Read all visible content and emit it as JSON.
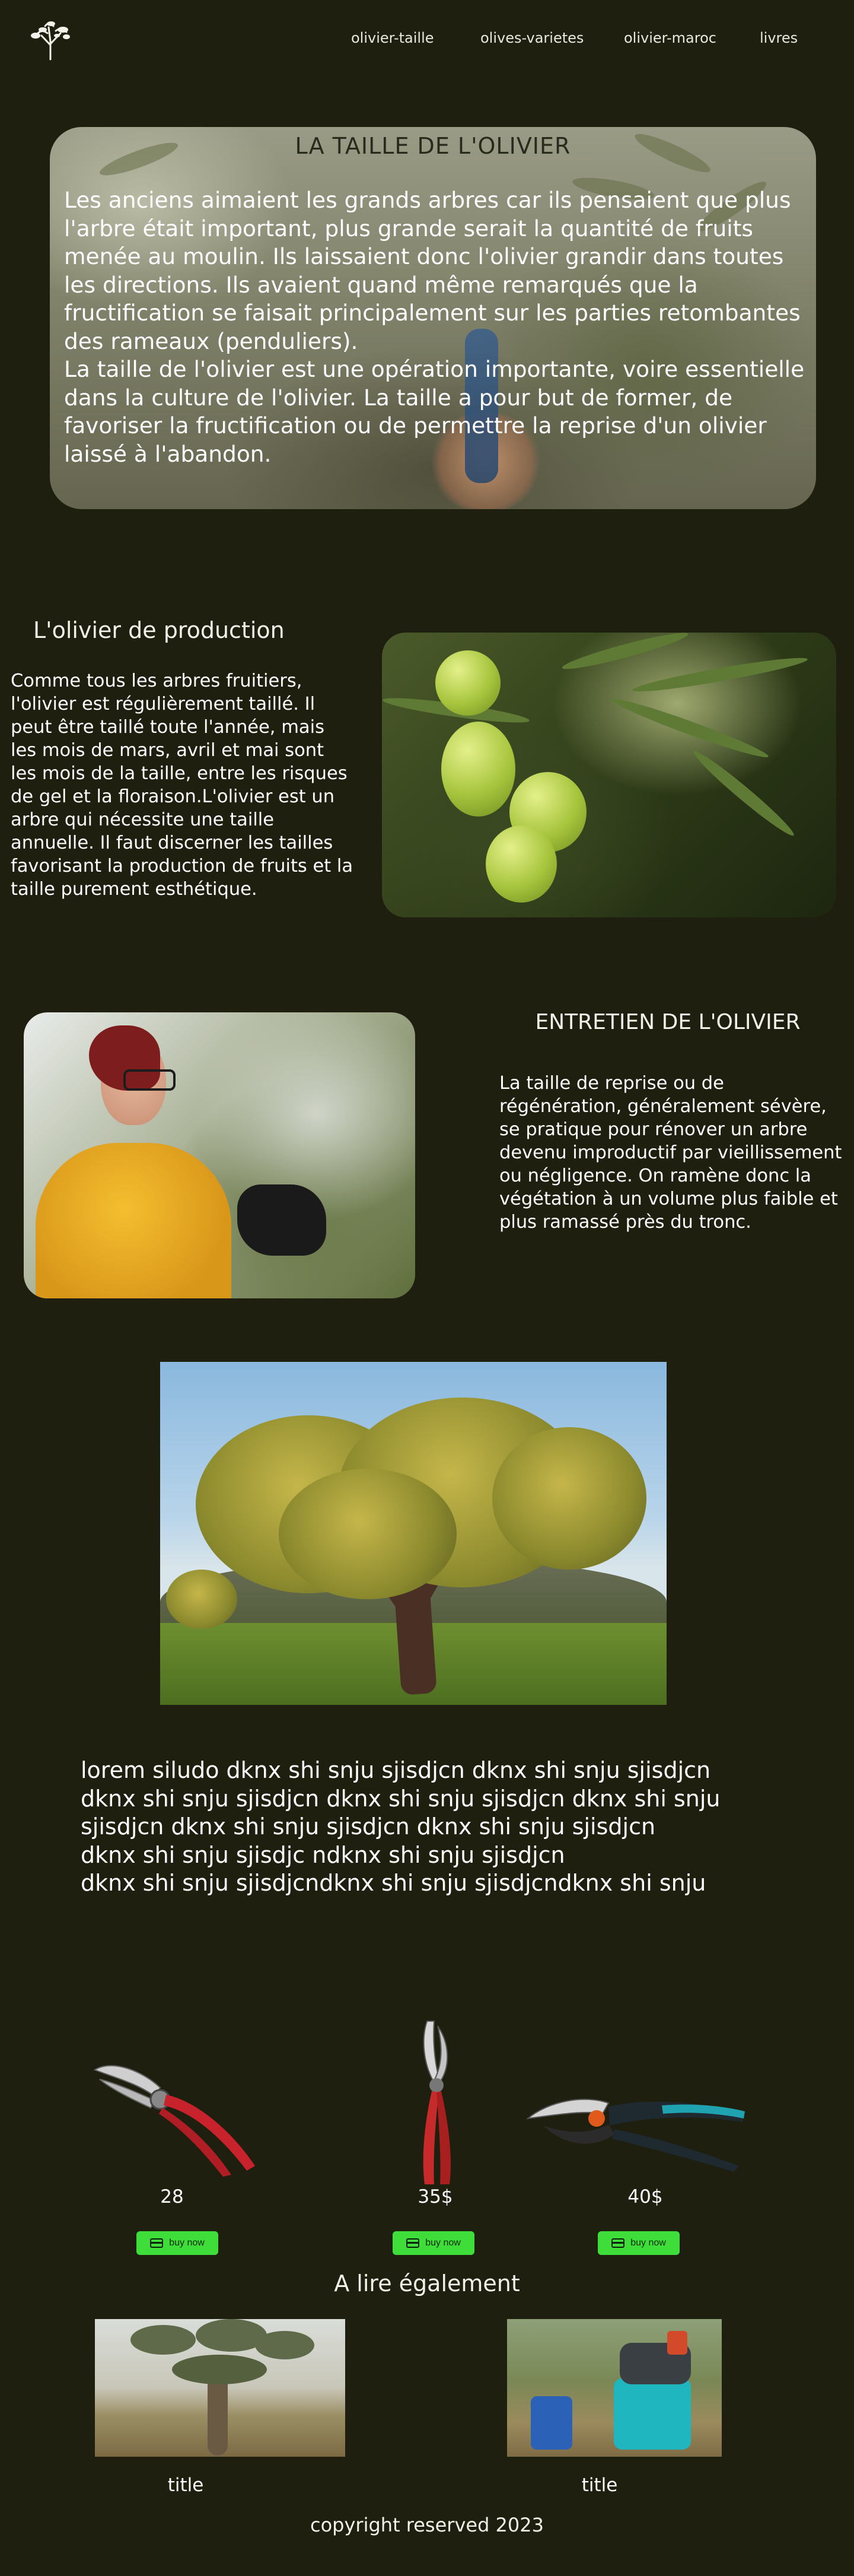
{
  "header": {
    "nav": [
      "olivier-taille",
      "olives-varietes",
      "olivier-maroc",
      "livres"
    ]
  },
  "hero": {
    "title": "LA TAILLE DE L'OLIVIER",
    "text_1": "Les anciens aimaient les grands arbres car ils pensaient que plus l'arbre était important, plus grande serait la quantité de fruits menée au moulin. Ils laissaient donc l'olivier grandir dans toutes les directions. Ils avaient quand même remarqués que la fructification se faisait principalement sur les parties retombantes des rameaux (penduliers).",
    "text_2": "La taille de l'olivier est une opération importante, voire essentielle dans la culture de l'olivier. La taille a pour but de former, de favoriser la fructification ou de permettre la reprise d'un olivier laissé à l'abandon."
  },
  "production": {
    "title": "L'olivier de production",
    "text": "Comme tous les arbres fruitiers, l'olivier est régulièrement taillé. Il peut être taillé toute l'année, mais les mois de mars, avril et mai sont les mois de la taille, entre les risques de gel et la floraison.L'olivier est un arbre qui nécessite une taille annuelle. Il faut discerner les tailles favorisant la production de fruits et la taille purement esthétique."
  },
  "entretien": {
    "title": "ENTRETIEN DE L'OLIVIER",
    "text": "La taille de reprise ou de régénération, généralement sévère, se pratique pour rénover un arbre devenu improductif par vieillissement ou négligence. On ramène donc la végétation à un volume plus faible et plus ramassé près du tronc."
  },
  "lorem": {
    "lines": [
      "lorem siludo dknx shi snju sjisdjcn dknx shi snju sjisdjcn",
      "dknx shi snju sjisdjcn dknx shi snju sjisdjcn dknx shi snju",
      "sjisdjcn dknx shi snju sjisdjcn dknx shi snju sjisdjcn",
      "dknx shi snju sjisdjc ndknx shi snju sjisdjcn",
      "dknx shi snju sjisdjcndknx shi snju sjisdjcndknx shi snju"
    ]
  },
  "products": [
    {
      "price": "28",
      "button": "buy now",
      "icon": "secateur-red-icon"
    },
    {
      "price": "35$",
      "button": "buy now",
      "icon": "secateur-vertical-icon"
    },
    {
      "price": "40$",
      "button": "buy now",
      "icon": "secateur-teal-icon"
    }
  ],
  "read_also": {
    "title": "A lire également",
    "items": [
      {
        "title": "title"
      },
      {
        "title": "title"
      }
    ]
  },
  "footer": {
    "copyright": "copyright reserved 2023"
  },
  "colors": {
    "background": "#1f1f10",
    "button": "#3fdd3a"
  }
}
